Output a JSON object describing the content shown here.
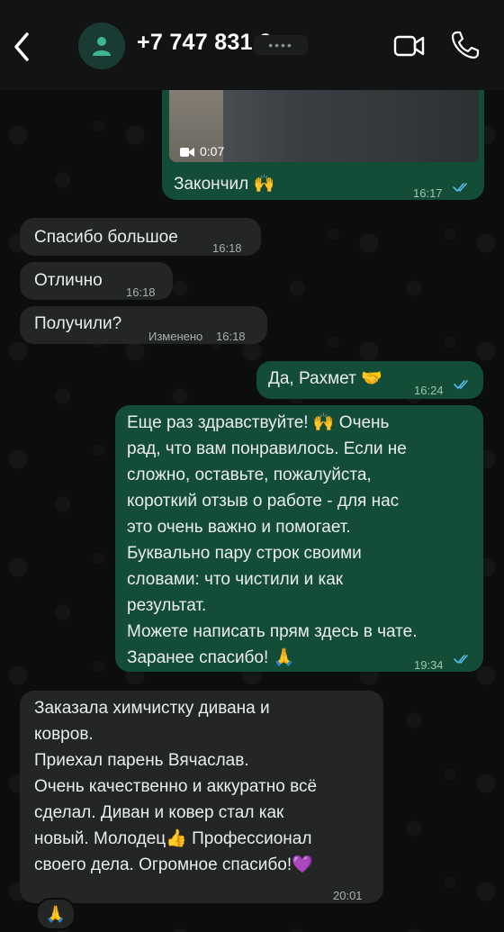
{
  "header": {
    "contact_name": "+7 747 831 9",
    "masked": "••••",
    "icons": [
      "chevron-left-icon",
      "person-icon",
      "video-camera-icon",
      "phone-icon"
    ]
  },
  "messages": [
    {
      "dir": "out",
      "type": "video",
      "duration": "0:07",
      "text": "Закончил 🙌",
      "time": "16:17",
      "status": "read"
    },
    {
      "dir": "in",
      "text": "Спасибо большое",
      "time": "16:18"
    },
    {
      "dir": "in",
      "text": "Отлично",
      "time": "16:18"
    },
    {
      "dir": "in",
      "text": "Получили?",
      "edited": "Изменено",
      "time": "16:18"
    },
    {
      "dir": "out",
      "text": "Да, Рахмет 🤝",
      "time": "16:24",
      "status": "read"
    },
    {
      "dir": "out",
      "text": "Еще раз здравствуйте! 🙌 Очень\nрад, что вам понравилось. Если не\nсложно, оставьте, пожалуйста,\nкороткий отзыв о работе - для нас\nэто очень важно и помогает.\nБуквально пару строк своими\nсловами: что чистили и как\nрезультат.\nМожете написать прям здесь в чате.\nЗаранее спасибо! 🙏",
      "time": "19:34",
      "status": "read"
    },
    {
      "dir": "in",
      "text": "Заказала химчистку дивана и\nковров.\nПриехал парень Вячаслав.\nОчень качественно и аккуратно всё\nсделал. Диван и ковер стал как\nновый.  Молодец👍 Профессионал\nсвоего дела. Огромное спасибо!💜",
      "time": "20:01",
      "reaction": "🙏"
    }
  ],
  "colors": {
    "incoming_bubble": "#242626",
    "outgoing_bubble": "#144d37",
    "read_ticks": "#53bdeb",
    "header_bg": "#121414"
  }
}
